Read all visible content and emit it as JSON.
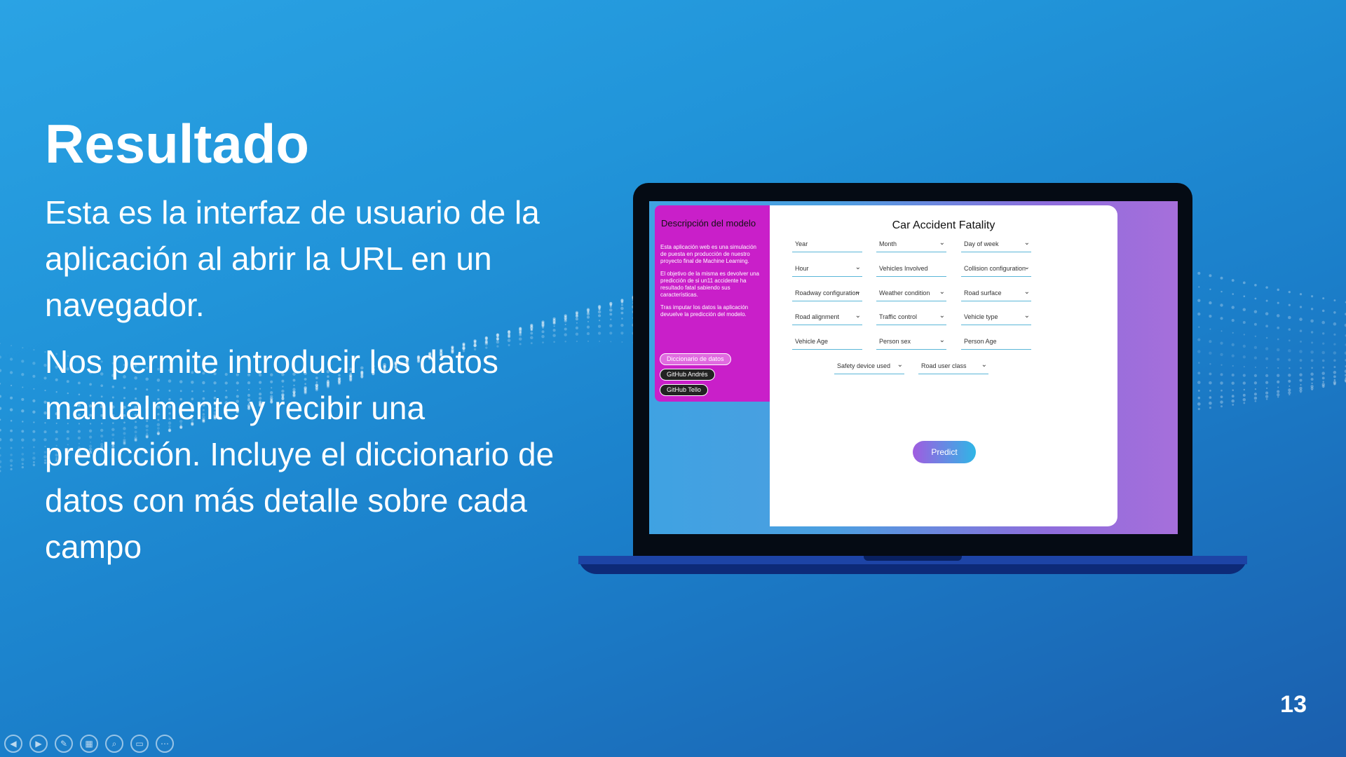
{
  "slide": {
    "title": "Resultado",
    "paragraph1": "Esta es la interfaz de usuario de la aplicación al abrir la URL en un navegador.",
    "paragraph2": "Nos permite introducir los datos manualmente y recibir una predicción. Incluye el diccionario de datos con más detalle sobre cada campo",
    "page_number": "13"
  },
  "app": {
    "sidebar": {
      "heading": "Descripción del modelo",
      "text1": "Esta aplicación web es una simulación de puesta en producción de nuestro proyecto final de Machine Learning.",
      "text2": "El objetivo de la misma es devolver una predicción de si un11 accidente ha resultado fatal sabiendo sus características.",
      "text3": "Tras imputar los datos la aplicación devuelve la predicción del modelo.",
      "links": [
        "Diccionario de datos",
        "GitHub Andrés",
        "GitHub Tello"
      ]
    },
    "title": "Car Accident Fatality",
    "fields": [
      {
        "label": "Year",
        "dropdown": false
      },
      {
        "label": "Month",
        "dropdown": true
      },
      {
        "label": "Day of week",
        "dropdown": true
      },
      {
        "label": "Hour",
        "dropdown": true
      },
      {
        "label": "Vehicles Involved",
        "dropdown": false
      },
      {
        "label": "Collision configuration",
        "dropdown": true
      },
      {
        "label": "Roadway configuration",
        "dropdown": true
      },
      {
        "label": "Weather condition",
        "dropdown": true
      },
      {
        "label": "Road surface",
        "dropdown": true
      },
      {
        "label": "Road alignment",
        "dropdown": true
      },
      {
        "label": "Traffic control",
        "dropdown": true
      },
      {
        "label": "Vehicle type",
        "dropdown": true
      },
      {
        "label": "Vehicle Age",
        "dropdown": false
      },
      {
        "label": "Person sex",
        "dropdown": true
      },
      {
        "label": "Person Age",
        "dropdown": false
      },
      {
        "label": "Safety device used",
        "dropdown": true
      },
      {
        "label": "Road user class",
        "dropdown": true
      }
    ],
    "predict_label": "Predict"
  },
  "controls": [
    "prev-icon",
    "next-icon",
    "pen-icon",
    "slides-icon",
    "zoom-icon",
    "subtitles-icon",
    "more-icon"
  ],
  "colors": {
    "sidebar": "#c91fc9",
    "accent_line": "#5ab6d8",
    "background": "#2194d9"
  }
}
